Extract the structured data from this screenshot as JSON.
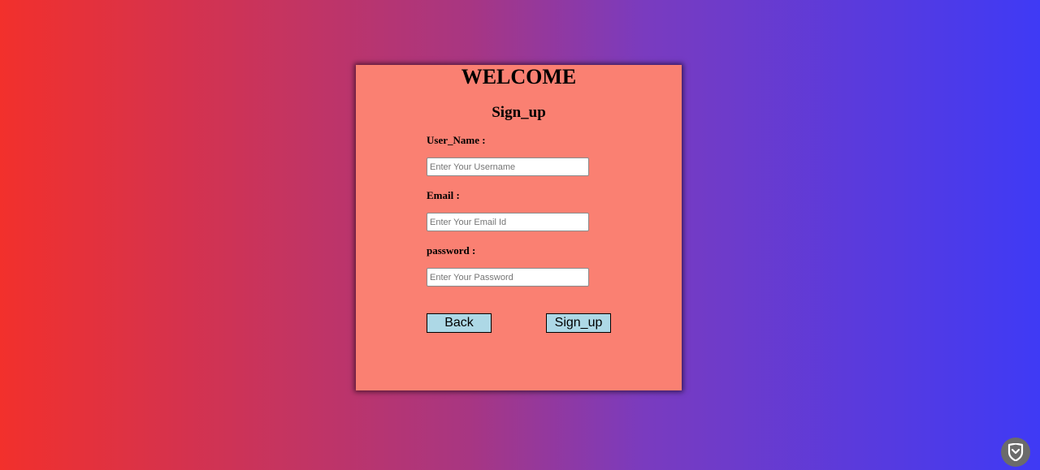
{
  "form": {
    "title": "WELCOME",
    "subtitle": "Sign_up",
    "username_label": "User_Name :",
    "username_placeholder": "Enter Your Username",
    "email_label": "Email :",
    "email_placeholder": "Enter Your Email Id",
    "password_label": "password :",
    "password_placeholder": "Enter Your Password",
    "back_button": "Back",
    "signup_button": "Sign_up"
  },
  "colors": {
    "card_background": "#fa8072",
    "button_background": "#add8e6",
    "gradient_left": "#f2302c",
    "gradient_right": "#3f3af5"
  },
  "widgets": {
    "corner_icon": "shield-icon"
  }
}
